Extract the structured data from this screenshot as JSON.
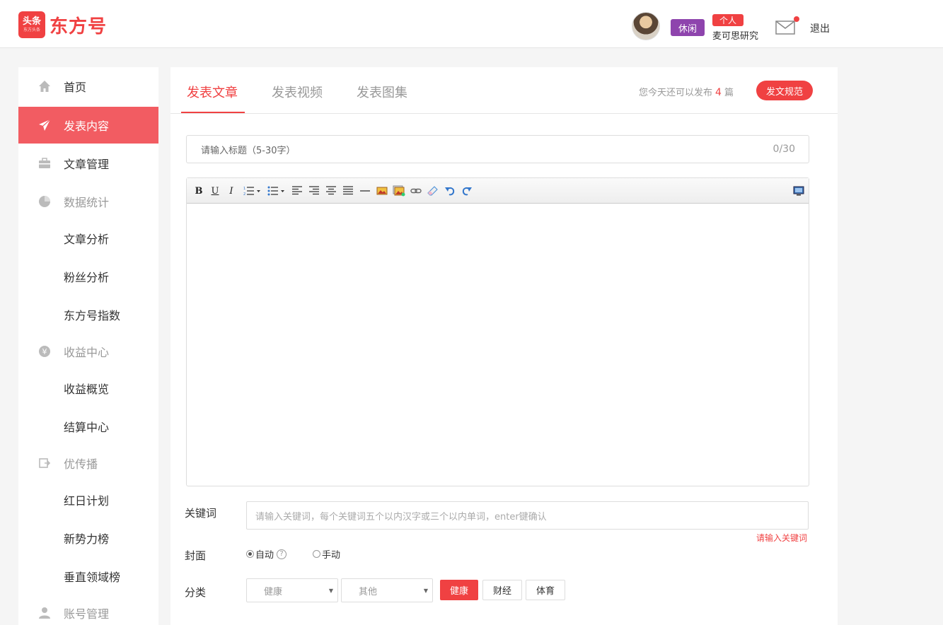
{
  "header": {
    "logo_badge": "头条",
    "logo_badge_sub": "东方头条",
    "logo_text": "东方号",
    "status_badge": "休闲",
    "account_type": "个人",
    "username": "麦可思研究",
    "logout": "退出"
  },
  "sidebar": {
    "items": [
      {
        "label": "首页",
        "icon": "home-icon"
      },
      {
        "label": "发表内容",
        "icon": "send-icon"
      },
      {
        "label": "文章管理",
        "icon": "briefcase-icon"
      },
      {
        "label": "数据统计",
        "icon": "pie-chart-icon"
      },
      {
        "label": "文章分析"
      },
      {
        "label": "粉丝分析"
      },
      {
        "label": "东方号指数"
      },
      {
        "label": "收益中心",
        "icon": "yen-icon"
      },
      {
        "label": "收益概览"
      },
      {
        "label": "结算中心"
      },
      {
        "label": "优传播",
        "icon": "share-icon"
      },
      {
        "label": "红日计划"
      },
      {
        "label": "新势力榜"
      },
      {
        "label": "垂直领域榜"
      },
      {
        "label": "账号管理",
        "icon": "user-icon"
      }
    ]
  },
  "tabs": [
    {
      "label": "发表文章"
    },
    {
      "label": "发表视频"
    },
    {
      "label": "发表图集"
    }
  ],
  "quota": {
    "prefix": "您今天还可以发布",
    "count": "4",
    "suffix": "篇"
  },
  "rules_button": "发文规范",
  "title_input": {
    "placeholder": "请输入标题（5-30字）",
    "counter": "0/30"
  },
  "keywords": {
    "label": "关键词",
    "placeholder": "请输入关键词，每个关键词五个以内汉字或三个以内单词，enter键确认",
    "error": "请输入关键词"
  },
  "cover": {
    "label": "封面",
    "options": [
      {
        "label": "自动",
        "selected": true
      },
      {
        "label": "手动",
        "selected": false
      }
    ]
  },
  "category": {
    "label": "分类",
    "select1": "健康",
    "select2": "其他",
    "buttons": [
      {
        "label": "健康",
        "active": true
      },
      {
        "label": "财经",
        "active": false
      },
      {
        "label": "体育",
        "active": false
      }
    ]
  },
  "colors": {
    "accent": "#f04142",
    "sidebar_active": "#f25c62",
    "status_badge": "#8e44ad"
  }
}
